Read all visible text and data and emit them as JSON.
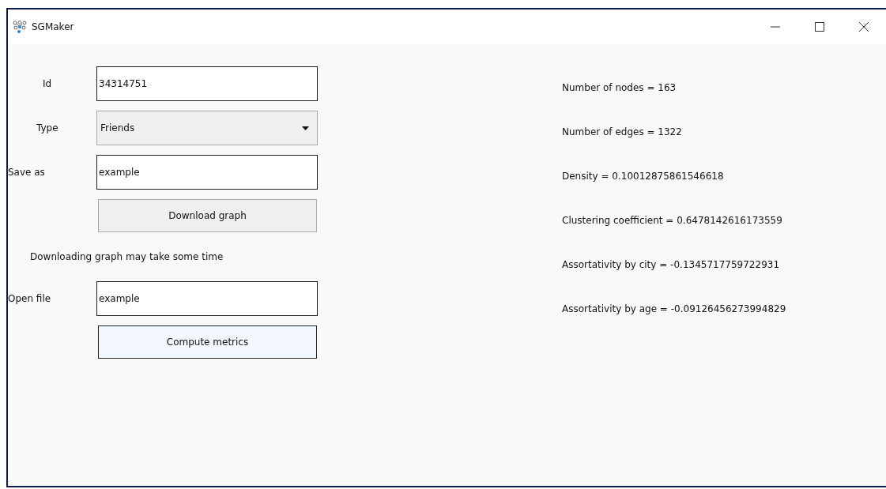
{
  "window": {
    "title": "SGMaker"
  },
  "form": [
    {
      "kind": "text",
      "label": "Id",
      "value": "34314751"
    },
    {
      "kind": "dropdown",
      "label": "Type",
      "value": "Friends"
    },
    {
      "kind": "text",
      "label": "Save as",
      "value": "example"
    },
    {
      "kind": "button",
      "label": "Download graph",
      "focused": false
    },
    {
      "kind": "note",
      "label": "Downloading graph may take some time"
    },
    {
      "kind": "text",
      "label": "Open file",
      "value": "example"
    },
    {
      "kind": "button",
      "label": "Compute metrics",
      "focused": true
    }
  ],
  "metrics": [
    "Number of nodes = 163",
    "Number of edges = 1322",
    "Density = 0.10012875861546618",
    "Clustering coefficient = 0.6478142616173559",
    "Assortativity by city = -0.1345717759722931",
    "Assortativity by age = -0.09126456273994829"
  ]
}
